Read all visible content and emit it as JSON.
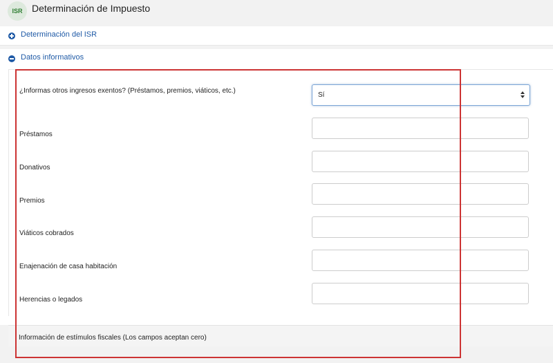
{
  "header": {
    "badge": "ISR",
    "title": "Determinación de Impuesto"
  },
  "sections": {
    "isr": {
      "title": "Determinación del ISR",
      "state": "collapsed"
    },
    "datos": {
      "title": "Datos informativos",
      "state": "expanded"
    }
  },
  "form": {
    "question": {
      "label": "¿Informas otros ingresos exentos? (Préstamos, premios, viáticos, etc.)",
      "value": "Sí"
    },
    "fields": [
      {
        "label": "Préstamos",
        "value": ""
      },
      {
        "label": "Donativos",
        "value": ""
      },
      {
        "label": "Premios",
        "value": ""
      },
      {
        "label": "Viáticos cobrados",
        "value": ""
      },
      {
        "label": "Enajenación de casa habitación",
        "value": ""
      },
      {
        "label": "Herencias o legados",
        "value": ""
      }
    ]
  },
  "estimulos": {
    "title": "Información de estímulos fiscales (Los campos aceptan cero)"
  },
  "colors": {
    "accent": "#1f5aa6",
    "highlight": "#cc3333",
    "badge_text": "#2e7d32"
  }
}
